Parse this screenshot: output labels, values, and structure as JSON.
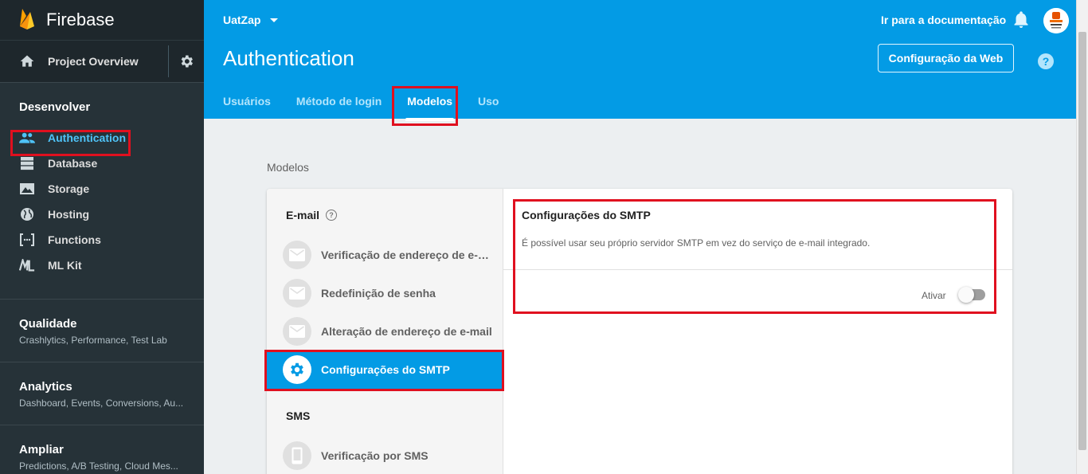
{
  "brand": {
    "name": "Firebase"
  },
  "sidebar": {
    "overview_label": "Project Overview",
    "develop_title": "Desenvolver",
    "nav_items": [
      {
        "label": "Authentication",
        "icon": "people-icon"
      },
      {
        "label": "Database",
        "icon": "database-icon"
      },
      {
        "label": "Storage",
        "icon": "storage-icon"
      },
      {
        "label": "Hosting",
        "icon": "globe-icon"
      },
      {
        "label": "Functions",
        "icon": "functions-icon"
      },
      {
        "label": "ML Kit",
        "icon": "mlkit-icon"
      }
    ],
    "groups": [
      {
        "title": "Qualidade",
        "subtitle": "Crashlytics, Performance, Test Lab"
      },
      {
        "title": "Analytics",
        "subtitle": "Dashboard, Events, Conversions, Au..."
      },
      {
        "title": "Ampliar",
        "subtitle": "Predictions, A/B Testing, Cloud Mes..."
      }
    ]
  },
  "header": {
    "project": "UatZap",
    "docs_link": "Ir para a documentação",
    "title": "Authentication",
    "web_config_button": "Configuração da Web",
    "help": "?",
    "tabs": [
      "Usuários",
      "Método de login",
      "Modelos",
      "Uso"
    ],
    "active_tab": "Modelos"
  },
  "content": {
    "section_title": "Modelos",
    "email_category": "E-mail",
    "sms_category": "SMS",
    "templates": [
      "Verificação de endereço de e-mail",
      "Redefinição de senha",
      "Alteração de endereço de e-mail",
      "Configurações do SMTP",
      "Verificação por SMS"
    ],
    "detail": {
      "title": "Configurações do SMTP",
      "description": "É possível usar seu próprio servidor SMTP em vez do serviço de e-mail integrado.",
      "toggle_label": "Ativar",
      "toggle_on": false
    }
  },
  "colors": {
    "header_blue": "#039be5",
    "sidebar_dark": "#263238",
    "highlight_red": "#e0101f"
  }
}
